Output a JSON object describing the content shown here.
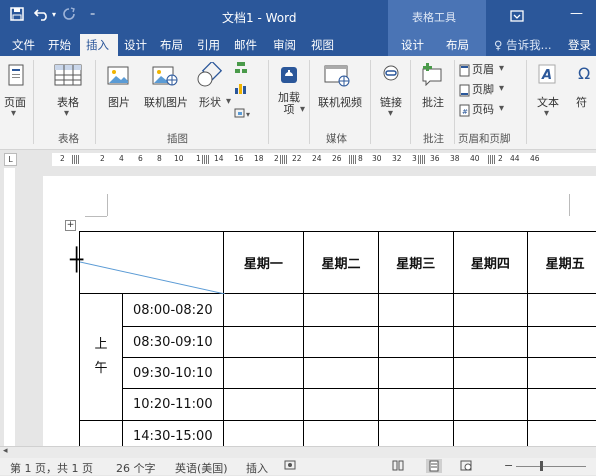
{
  "title_bar": {
    "doc_title": "文档1 - Word",
    "tools_title": "表格工具",
    "save_icon": "save-icon",
    "undo_icon": "undo-icon",
    "redo_icon": "redo-icon",
    "customize_icon": "customize-icon"
  },
  "tabs": {
    "file": "文件",
    "home": "开始",
    "insert": "插入",
    "design": "设计",
    "layout": "布局",
    "references": "引用",
    "mailings": "邮件",
    "review": "审阅",
    "view": "视图",
    "table_design": "设计",
    "table_layout": "布局",
    "tell_me": "♀ 告诉我...",
    "sign_in": "登录"
  },
  "ribbon": {
    "page": "页面",
    "table": "表格",
    "picture": "图片",
    "online_picture": "联机图片",
    "shapes": "形状",
    "addins": "加载\n项",
    "online_video": "联机视频",
    "link": "链接",
    "comment": "批注",
    "header": "页眉",
    "footer": "页脚",
    "page_number": "页码",
    "text": "文本",
    "symbol": "符",
    "groups": {
      "tables": "表格",
      "illustrations": "插图",
      "media": "媒体",
      "comments": "批注",
      "header_footer": "页眉和页脚"
    }
  },
  "ruler": {
    "numbers": [
      "2",
      "2",
      "4",
      "6",
      "8",
      "10",
      "1",
      "14",
      "16",
      "18",
      "2",
      "22",
      "24",
      "26",
      "8",
      "30",
      "32",
      "3",
      "36",
      "38",
      "40",
      "2",
      "44",
      "46"
    ]
  },
  "table": {
    "headers": [
      "星期一",
      "星期二",
      "星期三",
      "星期四",
      "星期五"
    ],
    "period_chars": [
      "上",
      "午"
    ],
    "times": [
      "08:00-08:20",
      "08:30-09:10",
      "09:30-10:10",
      "10:20-11:00",
      "14:30-15:00"
    ]
  },
  "status": {
    "page": "第 1 页，共 1 页",
    "words": "26 个字",
    "language": "英语(美国)",
    "mode": "插入"
  },
  "colors": {
    "brand_blue": "#2b579a",
    "tools_blue": "#4a74b5"
  }
}
